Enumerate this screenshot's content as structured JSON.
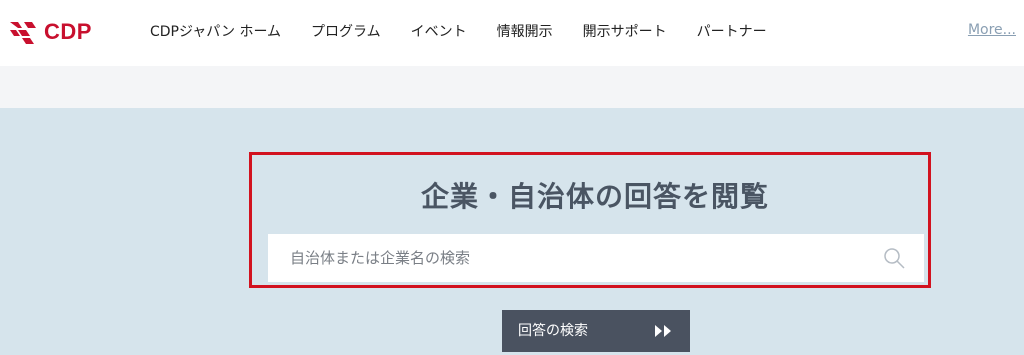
{
  "header": {
    "logo_text": "CDP",
    "nav": [
      {
        "label": "CDPジャパン ホーム"
      },
      {
        "label": "プログラム"
      },
      {
        "label": "イベント"
      },
      {
        "label": "情報開示"
      },
      {
        "label": "開示サポート"
      },
      {
        "label": "パートナー"
      }
    ],
    "more_label": "More..."
  },
  "search": {
    "title": "企業・自治体の回答を閲覧",
    "placeholder": "自治体または企業名の検索",
    "value": "",
    "submit_label": "回答の検索",
    "submit_icon": "double-chevron-right-icon",
    "search_icon": "search-icon"
  },
  "colors": {
    "brand_red": "#c8102e",
    "highlight_red": "#d2121f",
    "search_bg": "#d6e4ec",
    "button_bg": "#4a5260"
  }
}
